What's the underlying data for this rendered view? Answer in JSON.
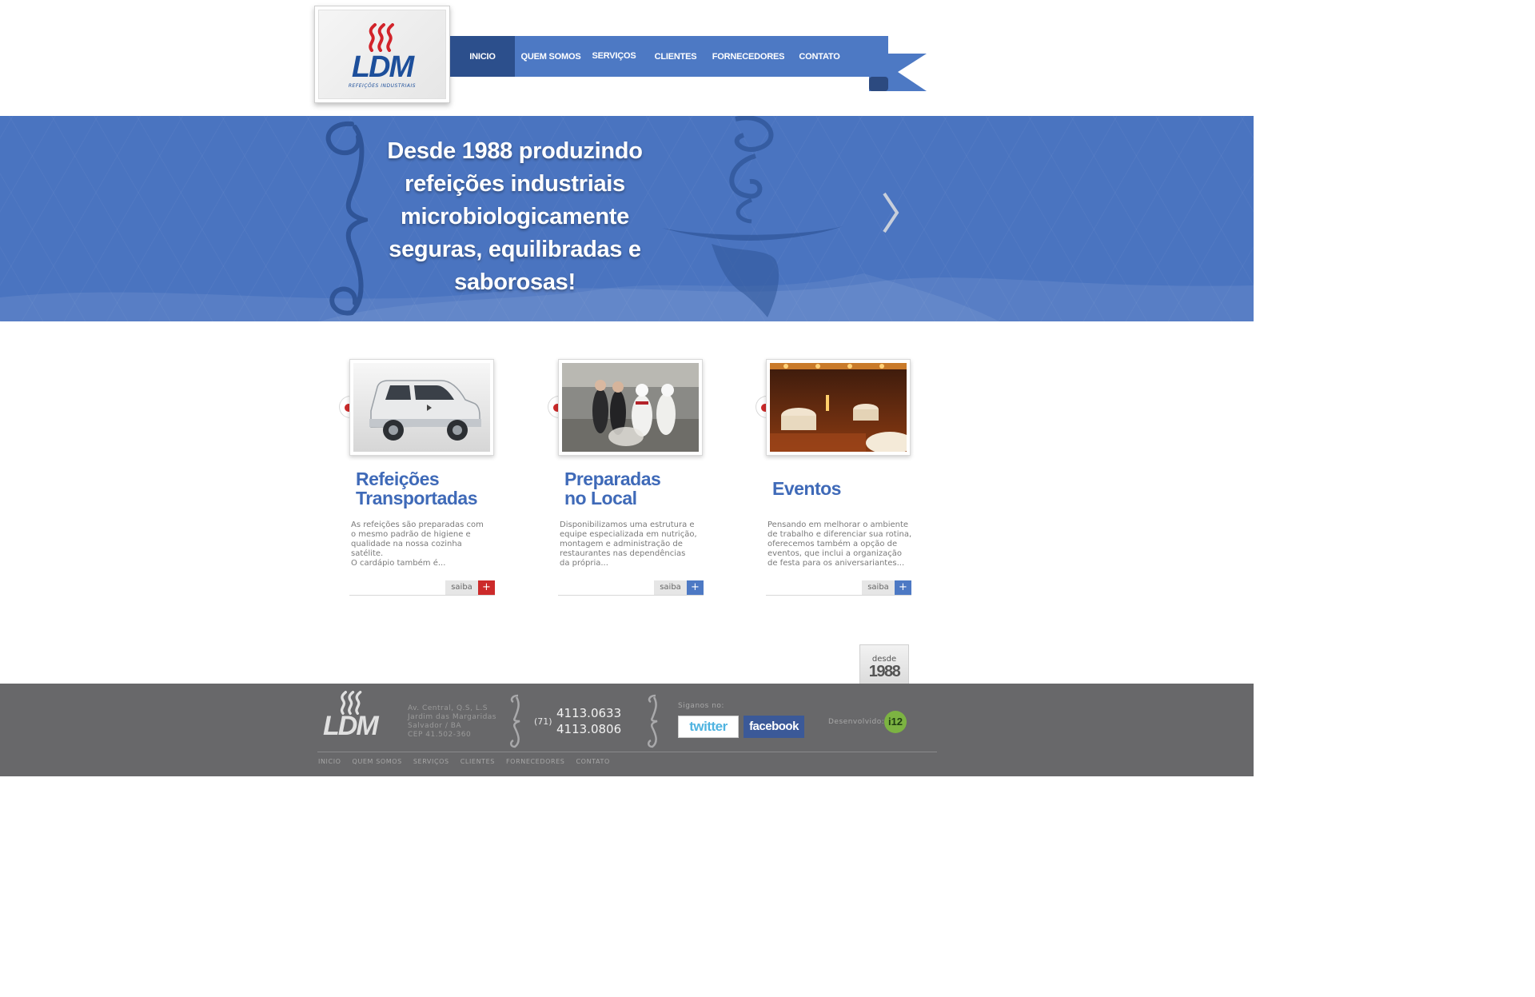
{
  "brand": {
    "logo_text": "LDM",
    "logo_sub": "REFEIÇÕES INDUSTRIAIS",
    "primary_color": "#4d79c4",
    "active_color": "#2c4f8c",
    "accent_red": "#cc2a2a"
  },
  "nav": {
    "items": [
      {
        "label": "INICIO",
        "active": true
      },
      {
        "label": "QUEM SOMOS",
        "active": false
      },
      {
        "label": "SERVIÇOS",
        "active": false
      },
      {
        "label": "CLIENTES",
        "active": false
      },
      {
        "label": "FORNECEDORES",
        "active": false
      },
      {
        "label": "CONTATO",
        "active": false
      }
    ]
  },
  "hero": {
    "headline": "Desde 1988 produzindo refeições industriais microbiologicamente seguras, equilibradas e saborosas!",
    "next_icon": "chevron-right-icon"
  },
  "cards": [
    {
      "title": "Refeições\nTransportadas",
      "description": "As refeições são preparadas com\no mesmo padrão de higiene e\nqualidade na nossa  cozinha\nsatélite.\nO cardápio também é...",
      "button_label": "saiba",
      "button_icon": "+",
      "button_color": "#cc2a2a",
      "image": "van-photo"
    },
    {
      "title": "Preparadas\nno Local",
      "description": "Disponibilizamos uma estrutura e\nequipe especializada em nutrição,\nmontagem e administração de\nrestaurantes nas dependências\nda própria...",
      "button_label": "saiba",
      "button_icon": "+",
      "button_color": "#4d79c4",
      "image": "kitchen-photo"
    },
    {
      "title": "Eventos",
      "description": "Pensando em melhorar o ambiente\nde trabalho e diferenciar sua rotina,\noferecemos também a opção de\neventos, que inclui a organização\nde festa para os aniversariantes...",
      "button_label": "saiba",
      "button_icon": "+",
      "button_color": "#4d79c4",
      "image": "event-hall-photo"
    }
  ],
  "badge": {
    "word": "desde",
    "year": "1988"
  },
  "footer": {
    "logo_text": "LDM",
    "address": [
      "Av. Central, Q.S, L.S",
      "Jardim das Margaridas",
      "Salvador / BA",
      "CEP 41.502-360"
    ],
    "ddd": "(71)",
    "phones": [
      "4113.0633",
      "4113.0806"
    ],
    "follow_label": "Siganos no:",
    "twitter_label": "twitter",
    "facebook_label": "facebook",
    "developer_label": "Desenvolvido:",
    "developer_logo": "i12",
    "nav": [
      "INICIO",
      "QUEM SOMOS",
      "SERVIÇOS",
      "CLIENTES",
      "FORNECEDORES",
      "CONTATO"
    ]
  }
}
